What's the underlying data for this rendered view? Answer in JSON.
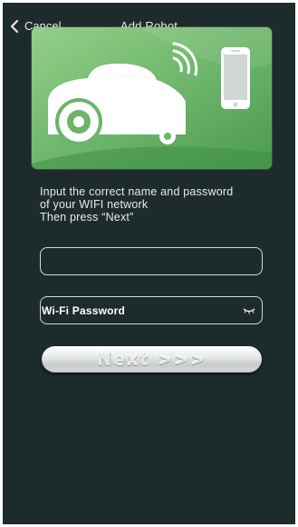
{
  "nav": {
    "back_label": "Cancel",
    "title": "Add Robot"
  },
  "hero": {
    "icons": [
      "robot-mower-icon",
      "wifi-signal-icon",
      "smartphone-icon"
    ],
    "colors": {
      "green_light": "#8dc982",
      "green_mid": "#5aa85c",
      "green_dark": "#3f8f47"
    }
  },
  "instructions": {
    "line1": "Input the correct name and password",
    "line2": "of your WIFI network",
    "line3": "Then press “Next”"
  },
  "form": {
    "ssid_value": "",
    "password_placeholder": "Wi-Fi Password",
    "password_toggle_icon": "eye-closed-icon"
  },
  "next_button": {
    "label": "Next >>>"
  },
  "colors": {
    "background": "#1e2b2c",
    "text": "#e8eaea"
  }
}
